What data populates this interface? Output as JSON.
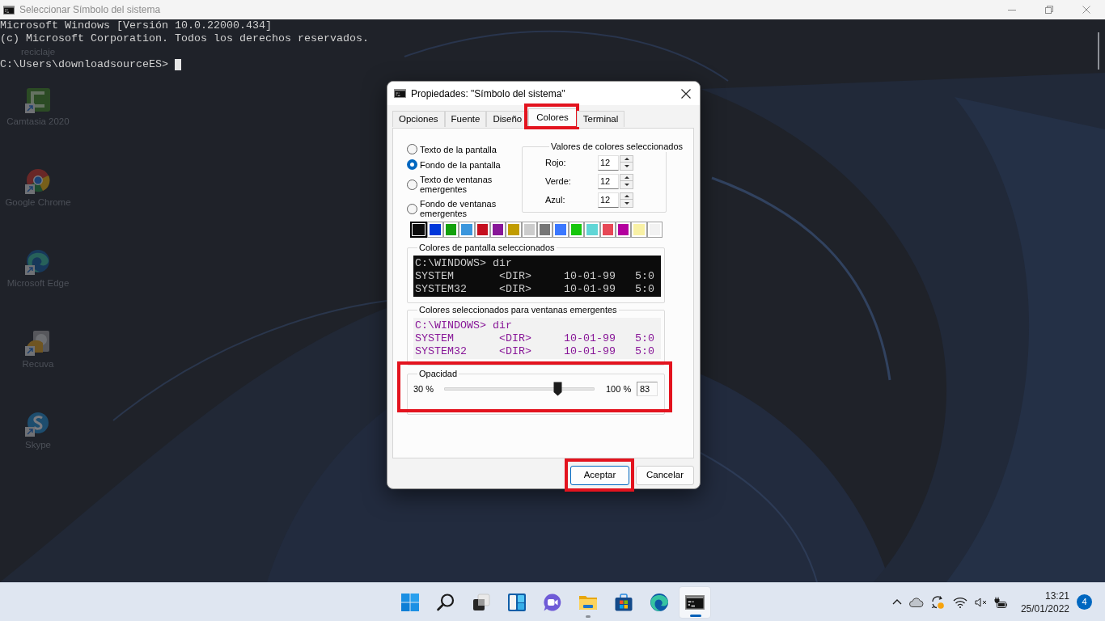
{
  "console": {
    "title": "Seleccionar Símbolo del sistema",
    "lines": [
      "Microsoft Windows [Versión 10.0.22000.434]",
      "(c) Microsoft Corporation. Todos los derechos reservados."
    ],
    "prompt": "C:\\Users\\downloadsourceES>"
  },
  "desktop_icons": [
    {
      "label": "reciclaje",
      "kind": "recycle"
    },
    {
      "label": "Camtasia 2020",
      "kind": "camtasia"
    },
    {
      "label": "Google Chrome",
      "kind": "chrome"
    },
    {
      "label": "Microsoft Edge",
      "kind": "edge"
    },
    {
      "label": "Recuva",
      "kind": "recuva"
    },
    {
      "label": "Skype",
      "kind": "skype"
    }
  ],
  "dialog": {
    "title": "Propiedades: \"Símbolo del sistema\"",
    "tabs": [
      {
        "label": "Opciones",
        "selected": false,
        "highlighted": false
      },
      {
        "label": "Fuente",
        "selected": false,
        "highlighted": false
      },
      {
        "label": "Diseño",
        "selected": false,
        "highlighted": false
      },
      {
        "label": "Colores",
        "selected": true,
        "highlighted": true
      },
      {
        "label": "Terminal",
        "selected": false,
        "highlighted": false
      }
    ],
    "radios": [
      {
        "label": "Texto de la pantalla",
        "selected": false
      },
      {
        "label": "Fondo de la pantalla",
        "selected": true
      },
      {
        "label": "Texto de ventanas emergentes",
        "selected": false
      },
      {
        "label": "Fondo de ventanas emergentes",
        "selected": false
      }
    ],
    "color_values": {
      "title": "Valores de colores seleccionados",
      "fields": [
        {
          "label": "Rojo:",
          "value": "12"
        },
        {
          "label": "Verde:",
          "value": "12"
        },
        {
          "label": "Azul:",
          "value": "12"
        }
      ]
    },
    "palette": [
      {
        "color": "#0c0c0c",
        "selected": true
      },
      {
        "color": "#0037da",
        "selected": false
      },
      {
        "color": "#13a10e",
        "selected": false
      },
      {
        "color": "#3a96dd",
        "selected": false
      },
      {
        "color": "#c50f1f",
        "selected": false
      },
      {
        "color": "#881798",
        "selected": false
      },
      {
        "color": "#c19c00",
        "selected": false
      },
      {
        "color": "#cccccc",
        "selected": false
      },
      {
        "color": "#767676",
        "selected": false
      },
      {
        "color": "#3b78ff",
        "selected": false
      },
      {
        "color": "#16c60c",
        "selected": false
      },
      {
        "color": "#61d6d6",
        "selected": false
      },
      {
        "color": "#e74856",
        "selected": false
      },
      {
        "color": "#b4009e",
        "selected": false
      },
      {
        "color": "#f9f1a5",
        "selected": false
      },
      {
        "color": "#f2f2f2",
        "selected": false
      }
    ],
    "previews": [
      {
        "kind": "screen",
        "title": "Colores de pantalla seleccionados",
        "command": "C:\\WINDOWS> dir",
        "rows": [
          [
            "SYSTEM",
            "<DIR>",
            "10-01-99",
            "5:0"
          ],
          [
            "SYSTEM32",
            "<DIR>",
            "10-01-99",
            "5:0"
          ]
        ]
      },
      {
        "kind": "popup",
        "title": "Colores seleccionados para ventanas emergentes",
        "command": "C:\\WINDOWS> dir",
        "rows": [
          [
            "SYSTEM",
            "<DIR>",
            "10-01-99",
            "5:0"
          ],
          [
            "SYSTEM32",
            "<DIR>",
            "10-01-99",
            "5:0"
          ]
        ]
      }
    ],
    "opacity": {
      "title": "Opacidad",
      "min_label": "30 %",
      "max_label": "100 %",
      "level": 0.757,
      "value": "83",
      "highlighted": true
    },
    "buttons": [
      {
        "label": "Aceptar",
        "default": true,
        "highlighted": true
      },
      {
        "label": "Cancelar",
        "default": false,
        "highlighted": false
      }
    ]
  },
  "taskbar": {
    "items": [
      {
        "kind": "start",
        "active": false,
        "running": false
      },
      {
        "kind": "search",
        "active": false,
        "running": false
      },
      {
        "kind": "task_view",
        "active": false,
        "running": false
      },
      {
        "kind": "widgets",
        "active": false,
        "running": false
      },
      {
        "kind": "chat",
        "active": false,
        "running": false
      },
      {
        "kind": "explorer",
        "active": false,
        "running": true
      },
      {
        "kind": "store",
        "active": false,
        "running": false
      },
      {
        "kind": "edge",
        "active": false,
        "running": false
      },
      {
        "kind": "terminal",
        "active": true,
        "running": true
      }
    ],
    "clock": {
      "time": "13:21",
      "date": "25/01/2022"
    },
    "notifications": "4"
  }
}
